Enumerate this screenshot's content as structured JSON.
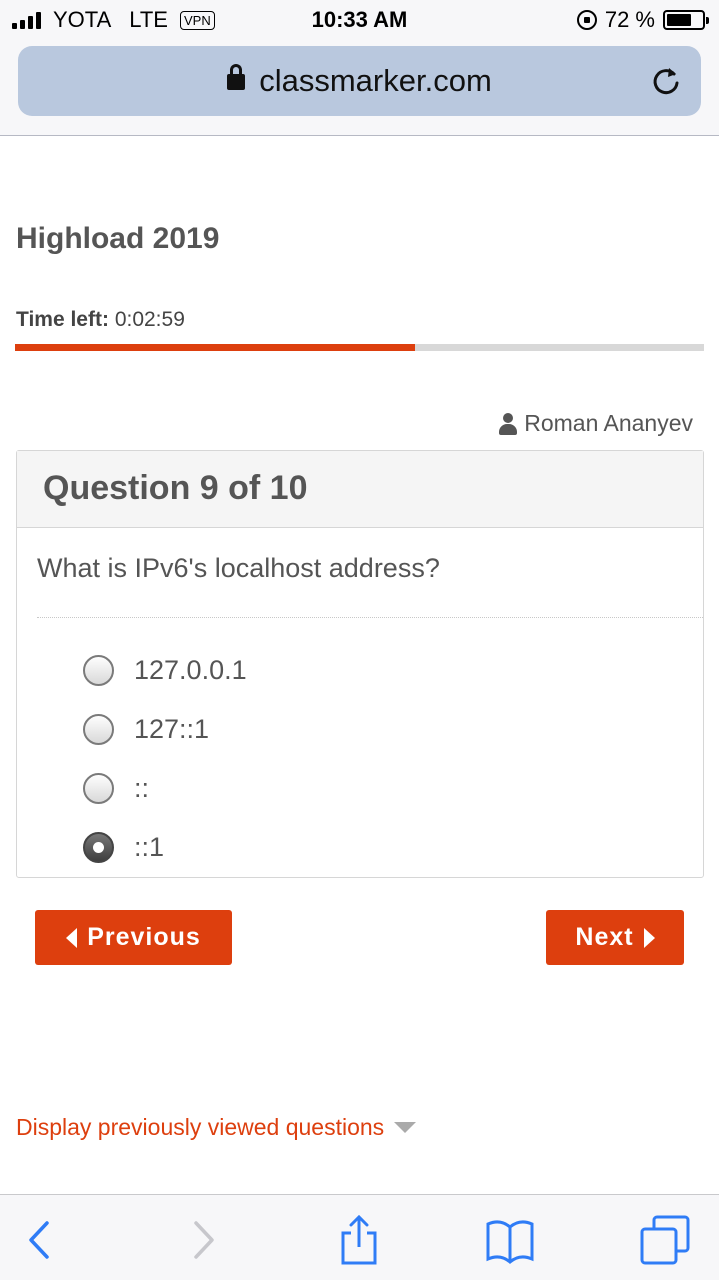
{
  "status_bar": {
    "carrier": "YOTA",
    "network": "LTE",
    "vpn": "VPN",
    "time": "10:33 AM",
    "battery": "72 %",
    "battery_level": 0.72
  },
  "address_bar": {
    "url": "classmarker.com"
  },
  "quiz": {
    "title": "Highload 2019",
    "time_left_label": "Time left:",
    "time_left_value": "0:02:59",
    "progress": 0.58,
    "user_name": "Roman Ananyev"
  },
  "question": {
    "header": "Question 9 of 10",
    "text": "What is IPv6's localhost address?",
    "options": [
      {
        "label": "127.0.0.1",
        "selected": false
      },
      {
        "label": "127::1",
        "selected": false
      },
      {
        "label": "::",
        "selected": false
      },
      {
        "label": "::1",
        "selected": true
      }
    ]
  },
  "nav": {
    "previous_label": "Previous",
    "next_label": "Next"
  },
  "footer": {
    "display_link": "Display previously viewed questions"
  },
  "colors": {
    "accent": "#dd3f0e",
    "url_bar": "#b9c8de",
    "ios_blue": "#2f7cf6"
  }
}
